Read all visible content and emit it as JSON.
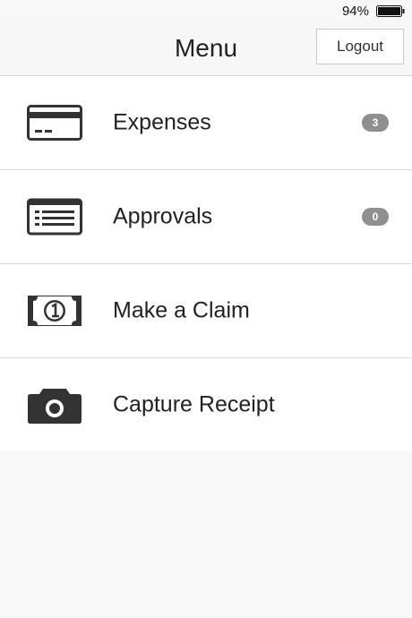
{
  "status_bar": {
    "battery_percent": "94%",
    "battery_level": 0.94
  },
  "nav": {
    "title": "Menu",
    "logout_label": "Logout"
  },
  "menu": {
    "items": [
      {
        "label": "Expenses",
        "icon": "credit-card-icon",
        "badge": "3"
      },
      {
        "label": "Approvals",
        "icon": "list-card-icon",
        "badge": "0"
      },
      {
        "label": "Make a Claim",
        "icon": "banknote-icon"
      },
      {
        "label": "Capture Receipt",
        "icon": "camera-icon"
      }
    ]
  },
  "colors": {
    "badge": "#8f8f8f",
    "icon": "#333333",
    "divider": "#d8d8d8"
  }
}
